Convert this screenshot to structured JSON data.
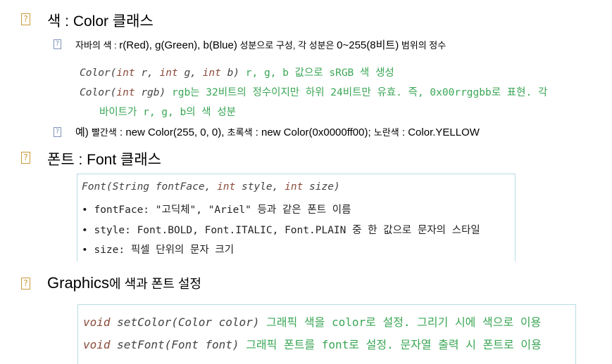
{
  "icon_glyph": "?",
  "section1": {
    "title": "색 : Color 클래스",
    "desc_a": "자바의 색 : ",
    "desc_b": "r(Red), g(Green), b(Blue)",
    "desc_c": " 성분으로 구성, 각 성분은 ",
    "desc_d": "0~255(8비트)",
    "desc_e": " 범위의 정수",
    "code1": {
      "cls": "Color(",
      "t1": "int",
      "a1": " r, ",
      "t2": "int",
      "a2": " g, ",
      "t3": "int",
      "a3": " b)",
      "desc": " r, g, b 값으로 sRGB 색 생성"
    },
    "code2": {
      "cls": "Color(",
      "t1": "int",
      "a1": " rgb)",
      "desc": " rgb는 32비트의 정수이지만 하위 24비트만 유효. 즉, 0x00rrggbb로 표현. 각"
    },
    "code2_cont": "바이트가 r, g, b의 색 성분",
    "example_a": "예) ",
    "example_b": "빨간색",
    "example_c": " : new Color(255, 0, 0), ",
    "example_d": "초록색",
    "example_e": " : new Color(0x0000ff00); ",
    "example_f": "노란색",
    "example_g": " : Color.YELLOW"
  },
  "section2": {
    "title": "폰트 : Font 클래스",
    "sig": {
      "cls": "Font(String fontFace, ",
      "t1": "int",
      "a1": " style, ",
      "t2": "int",
      "a2": " size)"
    },
    "items": [
      "• fontFace: \"고딕체\", \"Ariel\" 등과 같은 폰트 이름",
      "• style: Font.BOLD, Font.ITALIC, Font.PLAIN 중 한 값으로 문자의 스타일",
      "• size: 픽셀 단위의 문자 크기"
    ]
  },
  "section3": {
    "title_a": "Graphics",
    "title_b": "에 색과 폰트 설정",
    "m1": {
      "ret": "void",
      "sig": " setColor(Color color)",
      "desc": " 그래픽 색을 color로 설정. 그리기 시에 색으로 이용"
    },
    "m2": {
      "ret": "void",
      "sig": " setFont(Font font)",
      "desc": " 그래픽 폰트를 font로 설정. 문자열 출력 시 폰트로 이용"
    }
  }
}
